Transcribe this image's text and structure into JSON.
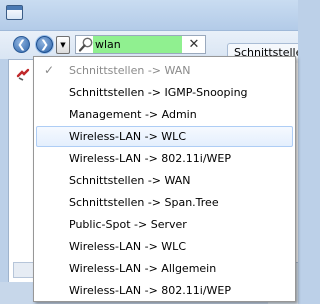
{
  "toolbar": {
    "back_glyph": "❮",
    "forward_glyph": "❯",
    "history_dropdown_glyph": "▼",
    "search": {
      "value": "wlan",
      "placeholder": ""
    },
    "clear_glyph": "✕"
  },
  "tab": {
    "label": "Schnittstellen"
  },
  "history_menu": {
    "items": [
      {
        "label": "Schnittstellen -> WAN",
        "state": "current"
      },
      {
        "label": "Schnittstellen -> IGMP-Snooping",
        "state": "normal"
      },
      {
        "label": "Management -> Admin",
        "state": "normal"
      },
      {
        "label": "Wireless-LAN -> WLC",
        "state": "highlighted"
      },
      {
        "label": "Wireless-LAN -> 802.11i/WEP",
        "state": "normal"
      },
      {
        "label": "Schnittstellen -> WAN",
        "state": "normal"
      },
      {
        "label": "Schnittstellen -> Span.Tree",
        "state": "normal"
      },
      {
        "label": "Public-Spot -> Server",
        "state": "normal"
      },
      {
        "label": "Wireless-LAN -> WLC",
        "state": "normal"
      },
      {
        "label": "Wireless-LAN -> Allgemein",
        "state": "normal"
      },
      {
        "label": "Wireless-LAN -> 802.11i/WEP",
        "state": "normal"
      }
    ],
    "check_glyph": "✓"
  },
  "colors": {
    "search_highlight": "#90f090",
    "nav_blue": "#2f66ab",
    "hover_border": "#aecdf5"
  }
}
